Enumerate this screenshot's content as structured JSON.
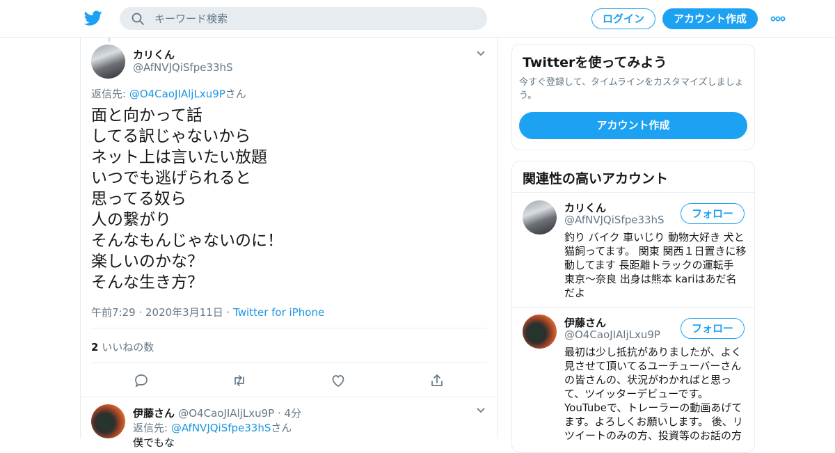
{
  "header": {
    "search_placeholder": "キーワード検索",
    "login_label": "ログイン",
    "signup_label": "アカウント作成"
  },
  "tweet": {
    "author_name": "カリくん",
    "author_handle": "@AfNVJQiSfpe33hS",
    "reply_prefix": "返信先: ",
    "reply_to": "@O4CaoJIAljLxu9P",
    "reply_suffix": "さん",
    "lines": [
      "面と向かって話",
      "してる訳じゃないから",
      "ネット上は言いたい放題",
      "いつでも逃げられると",
      "思ってる奴ら",
      "人の繋がり",
      "そんなもんじゃないのに！",
      "楽しいのかな？",
      "そんな生き方？"
    ],
    "time": "午前7:29 · 2020年3月11日 · ",
    "source": "Twitter for iPhone",
    "like_count": "2",
    "like_label": " いいねの数"
  },
  "reply": {
    "author_name": "伊藤さん",
    "author_handle": "@O4CaoJIAljLxu9P",
    "age": " · 4分",
    "reply_prefix": "返信先: ",
    "reply_to": "@AfNVJQiSfpe33hS",
    "reply_suffix": "さん",
    "text": "僕でもな"
  },
  "signup_card": {
    "title": "Twitterを使ってみよう",
    "description": "今すぐ登録して、タイムラインをカスタマイズしましょう。",
    "button": "アカウント作成"
  },
  "related": {
    "title": "関連性の高いアカウント",
    "accounts": [
      {
        "name": "カリくん",
        "handle": "@AfNVJQiSfpe33hS",
        "follow": "フォロー",
        "bio": "釣り バイク 車いじり 動物大好き 犬と猫飼ってます。 関東 関西１日置きに移動してます 長距離トラックの運転手 東京〜奈良 出身は熊本 kariはあだ名だよ"
      },
      {
        "name": "伊藤さん",
        "handle": "@O4CaoJIAljLxu9P",
        "follow": "フォロー",
        "bio": "最初は少し抵抗がありましたが、よく見させて頂いてるユーチューバーさんの皆さんの、状況がわかればと思って、ツイッターデビューです。YouTubeで、トレーラーの動画あげてます。よろしくお願いします。 後、リツイートのみの方、投資等のお話の方"
      }
    ]
  },
  "colors": {
    "accent": "#1da1f2",
    "link": "#1b95e0",
    "muted": "#657786",
    "border": "#e6ecf0"
  }
}
